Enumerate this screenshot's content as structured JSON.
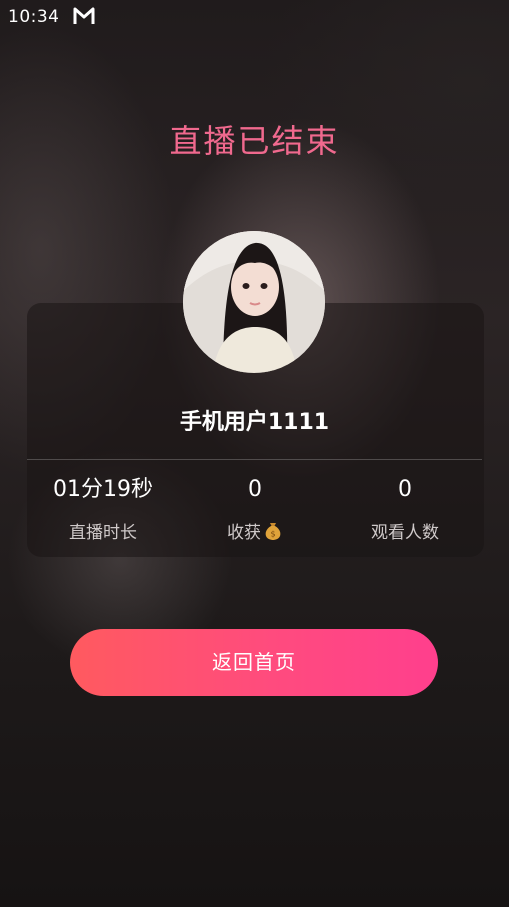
{
  "status_bar": {
    "time": "10:34",
    "notification_icon": "m-app-icon"
  },
  "end_screen": {
    "title": "直播已结束",
    "title_color": "#f0698e",
    "avatar_icon": "user-avatar-photo",
    "username": "手机用户1111"
  },
  "stats": [
    {
      "value": "01分19秒",
      "label": "直播时长"
    },
    {
      "value": "0",
      "label": "收获",
      "icon": "money-bag-icon"
    },
    {
      "value": "0",
      "label": "观看人数"
    }
  ],
  "actions": {
    "home_label": "返回首页",
    "button_gradient": [
      "#ff5a5f",
      "#ff3f8d"
    ]
  }
}
